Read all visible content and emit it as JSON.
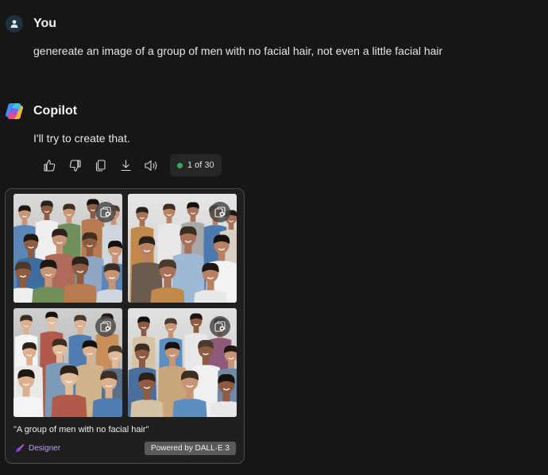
{
  "user_message": {
    "sender": "You",
    "text": "genereate an image of a group of men with no facial hair, not even a little facial hair"
  },
  "assistant_message": {
    "sender": "Copilot",
    "text": "I'll try to create that.",
    "actions": {
      "like_icon": "thumbs-up-icon",
      "dislike_icon": "thumbs-down-icon",
      "copy_icon": "copy-icon",
      "export_icon": "download-icon",
      "read_aloud_icon": "speaker-icon"
    },
    "response_counter": "1 of 30"
  },
  "image_card": {
    "caption": "\"A group of men with no facial hair\"",
    "source_label": "Designer",
    "powered_by": "Powered by DALL·E 3",
    "images": [
      {
        "name": "generated-image-1"
      },
      {
        "name": "generated-image-2"
      },
      {
        "name": "generated-image-3"
      },
      {
        "name": "generated-image-4"
      }
    ]
  },
  "colors": {
    "background": "#161616",
    "card_background": "#1f1f1f",
    "status_dot": "#3aa854",
    "designer_accent": "#b9a3f5"
  }
}
